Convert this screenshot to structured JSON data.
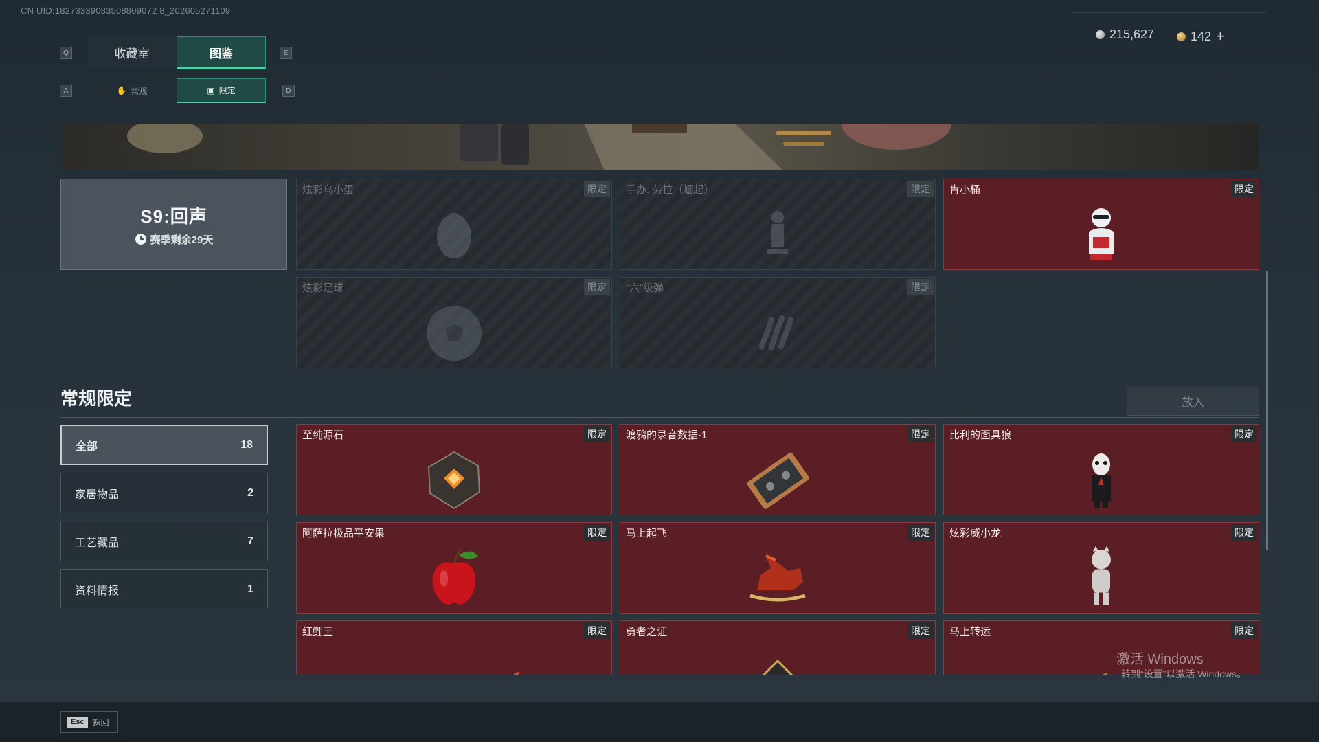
{
  "uid": "CN UID:18273339083508809072 8_202605271109",
  "tabs": {
    "key_left": "Q",
    "key_right": "E",
    "items": [
      {
        "label": "收藏室"
      },
      {
        "label": "图鉴"
      }
    ]
  },
  "subtabs": {
    "key_left": "A",
    "key_right": "D",
    "items": [
      {
        "label": "常规"
      },
      {
        "label": "限定"
      }
    ]
  },
  "currency": {
    "silver": "215,627",
    "gold": "142",
    "add": "+"
  },
  "season": {
    "title": "S9:回声",
    "remaining": "赛季剩余29天"
  },
  "season_items": [
    {
      "name": "炫彩乌小蛋",
      "badge": "限定",
      "icon": "egg-icon"
    },
    {
      "name": "手办: 劳拉（崛起）",
      "badge": "限定",
      "icon": "figurine-icon"
    },
    {
      "name": "肯小桶",
      "badge": "限定",
      "icon": "colonel-bust-icon"
    },
    {
      "name": "炫彩足球",
      "badge": "限定",
      "icon": "football-icon"
    },
    {
      "name": "“六”级弹",
      "badge": "限定",
      "icon": "bullets-icon"
    }
  ],
  "section": {
    "title": "常规限定",
    "put_in": "放入"
  },
  "categories": [
    {
      "label": "全部",
      "count": "18"
    },
    {
      "label": "家居物品",
      "count": "2"
    },
    {
      "label": "工艺藏品",
      "count": "7"
    },
    {
      "label": "资料情报",
      "count": "1"
    }
  ],
  "items": [
    {
      "name": "至纯源石",
      "badge": "限定",
      "icon": "crystal-icon"
    },
    {
      "name": "渡鸦的录音数据-1",
      "badge": "限定",
      "icon": "cassette-icon"
    },
    {
      "name": "比利的面具狼",
      "badge": "限定",
      "icon": "puppet-icon"
    },
    {
      "name": "阿萨拉极品平安果",
      "badge": "限定",
      "icon": "apple-icon"
    },
    {
      "name": "马上起飞",
      "badge": "限定",
      "icon": "horse-icon"
    },
    {
      "name": "炫彩威小龙",
      "badge": "限定",
      "icon": "dragon-figure-icon"
    },
    {
      "name": "红鲤王",
      "badge": "限定",
      "icon": "carp-icon"
    },
    {
      "name": "勇者之证",
      "badge": "限定",
      "icon": "card-icon"
    },
    {
      "name": "马上转运",
      "badge": "限定",
      "icon": "gold-horse-icon"
    }
  ],
  "footer": {
    "esc_key": "Esc",
    "esc_label": "返回"
  },
  "watermark": {
    "line1": "激活 Windows",
    "line2": "转到“设置”以激活 Windows。"
  },
  "colors": {
    "accent": "#4ad3a6",
    "owned_card": "#5b1e25",
    "locked_card": "#262b30"
  }
}
